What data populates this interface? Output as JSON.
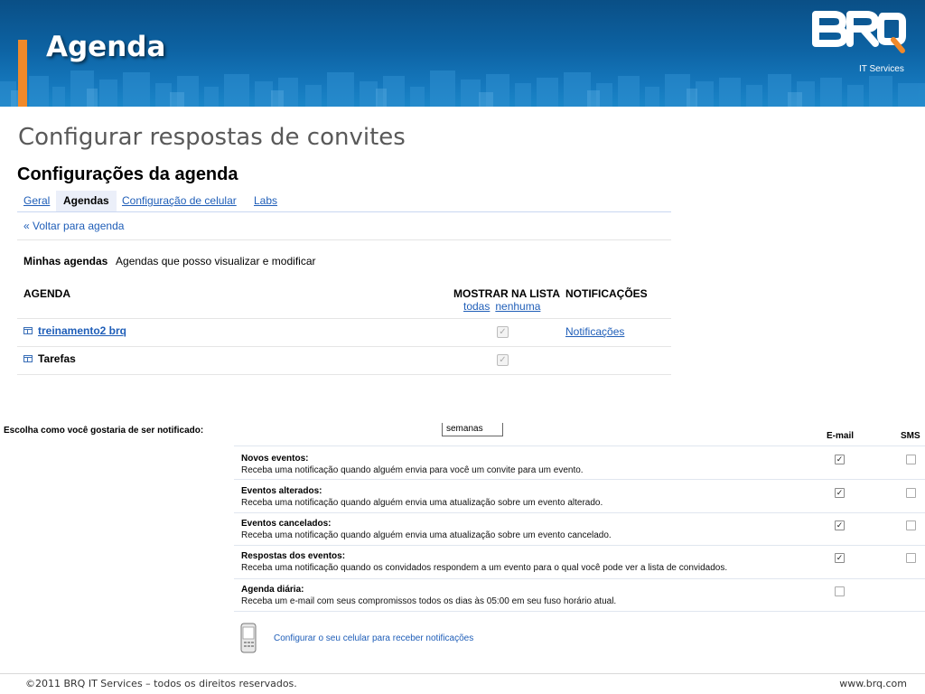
{
  "banner": {
    "title": "Agenda",
    "logo_text": "BRQ",
    "logo_sub": "IT Services",
    "colors": {
      "banner_dark": "#0a4f86",
      "banner_light": "#1a86c8",
      "accent": "#f0892a"
    }
  },
  "slide": {
    "subtitle": "Configurar respostas de convites"
  },
  "calendar": {
    "heading": "Configurações da agenda",
    "tabs": [
      {
        "label": "Geral",
        "active": false
      },
      {
        "label": "Agendas",
        "active": true
      },
      {
        "label": "Configuração de celular",
        "active": false
      },
      {
        "label": "Labs",
        "active": false
      }
    ],
    "back_link": "« Voltar para agenda",
    "my_calendars_label": "Minhas agendas",
    "my_calendars_desc": "Agendas que posso visualizar e modificar",
    "columns": {
      "agenda": "AGENDA",
      "show_in_list": "MOSTRAR NA LISTA",
      "notifications": "NOTIFICAÇÕES"
    },
    "show_links": {
      "all": "todas",
      "none": "nenhuma"
    },
    "rows": [
      {
        "name": "treinamento2 brq",
        "icon": "calendar-icon",
        "show": true,
        "notifications_link": "Notificações"
      },
      {
        "name": "Tarefas",
        "icon": "calendar-icon",
        "show": true,
        "notifications_link": ""
      }
    ]
  },
  "notify": {
    "choose_label": "Escolha como você gostaria de ser notificado:",
    "weeks_value": "semanas",
    "col_email": "E-mail",
    "col_sms": "SMS",
    "rows": [
      {
        "title": "Novos eventos:",
        "desc": "Receba uma notificação quando alguém envia para você um convite para um evento.",
        "email": true,
        "sms": false
      },
      {
        "title": "Eventos alterados:",
        "desc": "Receba uma notificação quando alguém envia uma atualização sobre um evento alterado.",
        "email": true,
        "sms": false
      },
      {
        "title": "Eventos cancelados:",
        "desc": "Receba uma notificação quando alguém envia uma atualização sobre um evento cancelado.",
        "email": true,
        "sms": false
      },
      {
        "title": "Respostas dos eventos:",
        "desc": "Receba uma notificação quando os convidados respondem a um evento para o qual você pode ver a lista de convidados.",
        "email": true,
        "sms": false
      },
      {
        "title": "Agenda diária:",
        "desc": "Receba um e-mail com seus compromissos todos os dias às 05:00 em seu fuso horário atual.",
        "email": false,
        "sms": null
      }
    ],
    "phone_link": "Configurar o seu celular para receber notificações"
  },
  "footer": {
    "copyright": "©2011 BRQ IT Services – todos os direitos reservados.",
    "site": "www.brq.com"
  }
}
